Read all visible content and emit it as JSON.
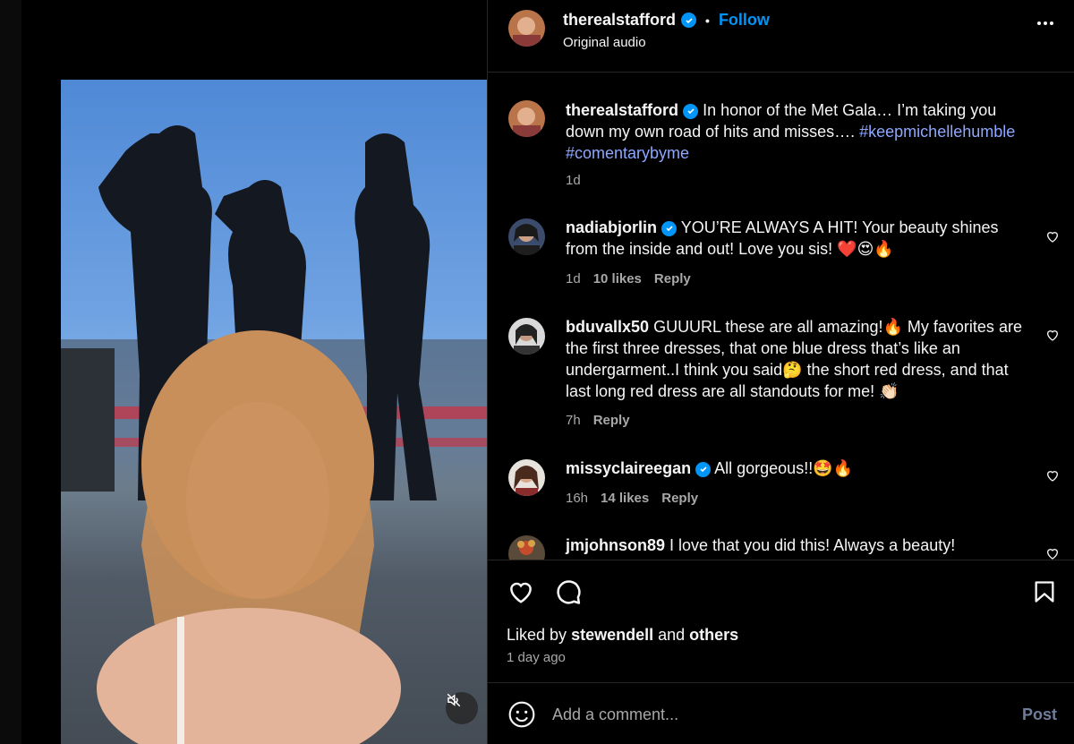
{
  "post": {
    "username": "therealstafford",
    "follow_label": "Follow",
    "audio": "Original audio"
  },
  "caption": {
    "username": "therealstafford",
    "text": "In honor of the Met Gala… I’m taking you down my own road of hits and misses…. ",
    "hashtag1": "#keepmichellehumble",
    "hashtag2": "#comentarybyme",
    "time": "1d"
  },
  "comments": [
    {
      "username": "nadiabjorlin",
      "verified": true,
      "text": "YOU’RE ALWAYS A HIT! Your beauty shines from the inside and out! Love you sis! ❤️😍🔥",
      "time": "1d",
      "likes": "10 likes",
      "reply": "Reply"
    },
    {
      "username": "bduvallx50",
      "verified": false,
      "text": "GUUURL these are all amazing!🔥 My favorites are the first three dresses, that one blue dress that’s like an undergarment..I think you said🤔 the short red dress, and that last long red dress are all standouts for me! 👏🏻",
      "time": "7h",
      "likes": "",
      "reply": "Reply"
    },
    {
      "username": "missyclaireegan",
      "verified": true,
      "text": "All gorgeous!!🤩🔥",
      "time": "16h",
      "likes": "14 likes",
      "reply": "Reply"
    },
    {
      "username": "jmjohnson89",
      "verified": false,
      "text": "I love that you did this! Always a beauty!",
      "time": "",
      "likes": "",
      "reply": ""
    }
  ],
  "likes": {
    "prefix": "Liked by",
    "user": "stewendell",
    "and": "and",
    "others": "others",
    "time_ago": "1 day ago"
  },
  "add_comment": {
    "placeholder": "Add a comment...",
    "post_label": "Post"
  },
  "colors": {
    "accent": "#0095f6",
    "hashtag": "#8ea7ff",
    "muted": "#a8a8a8"
  }
}
